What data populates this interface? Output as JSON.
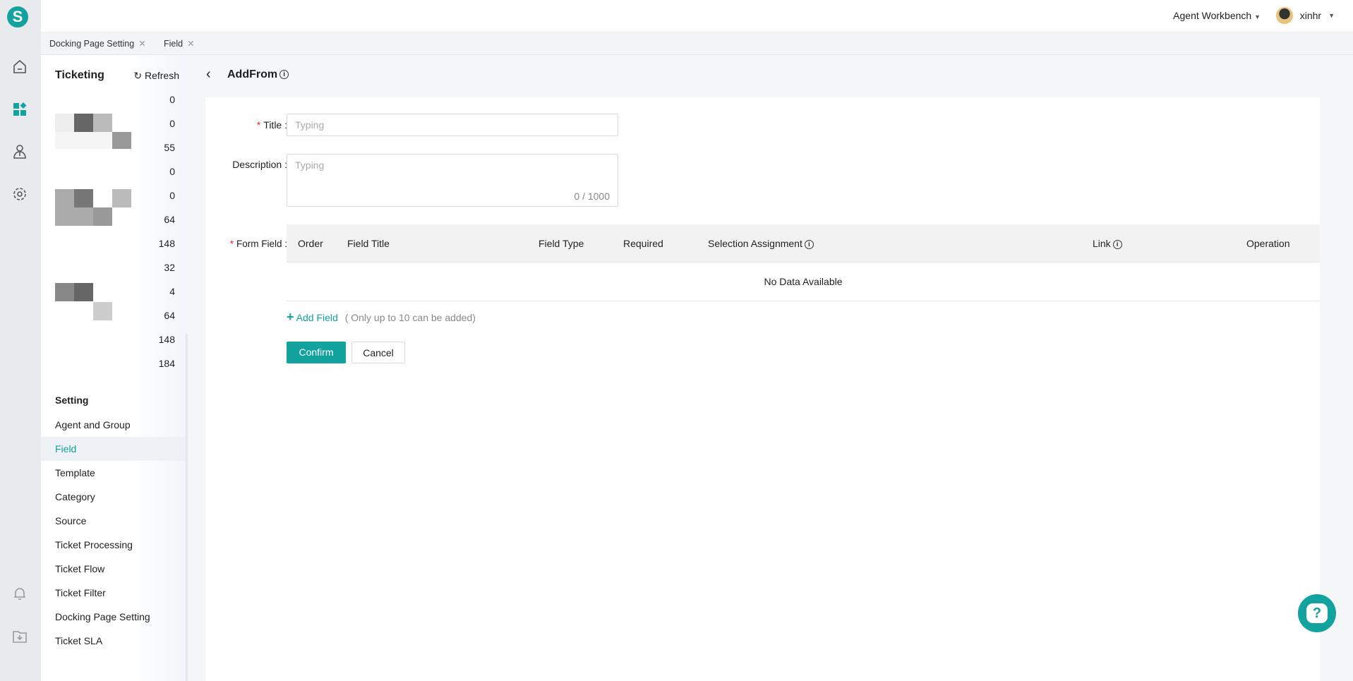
{
  "app": {
    "logo_letter": "S",
    "brand_color": "#12a39e"
  },
  "rail": {
    "icons": [
      "home-icon",
      "apps-icon",
      "agent-icon",
      "gear-icon",
      "bell-icon",
      "download-icon"
    ]
  },
  "header": {
    "workbench": "Agent Workbench",
    "user": "xinhr"
  },
  "tabs": [
    {
      "label": "Docking Page Setting"
    },
    {
      "label": "Field"
    }
  ],
  "sidebar": {
    "title": "Ticketing",
    "refresh": "Refresh",
    "counts": [
      "0",
      "0",
      "55",
      "0",
      "0",
      "64",
      "148",
      "32",
      "4",
      "64",
      "148",
      "184"
    ],
    "setting_title": "Setting",
    "items": [
      {
        "label": "Agent and Group"
      },
      {
        "label": "Field",
        "active": true
      },
      {
        "label": "Template"
      },
      {
        "label": "Category"
      },
      {
        "label": "Source"
      },
      {
        "label": "Ticket Processing"
      },
      {
        "label": "Ticket Flow"
      },
      {
        "label": "Ticket Filter"
      },
      {
        "label": "Docking Page Setting"
      },
      {
        "label": "Ticket SLA"
      }
    ]
  },
  "page": {
    "title": "AddFrom",
    "form": {
      "title_label": "Title",
      "title_placeholder": "Typing",
      "desc_label": "Description",
      "desc_placeholder": "Typing",
      "desc_counter": "0 / 1000",
      "form_field_label": "Form Field",
      "columns": [
        "Order",
        "Field Title",
        "Field Type",
        "Required",
        "Selection Assignment",
        "Link",
        "Operation"
      ],
      "empty": "No Data Available",
      "add_field": "Add Field",
      "add_hint": "( Only up to 10 can be added)",
      "confirm": "Confirm",
      "cancel": "Cancel"
    }
  }
}
